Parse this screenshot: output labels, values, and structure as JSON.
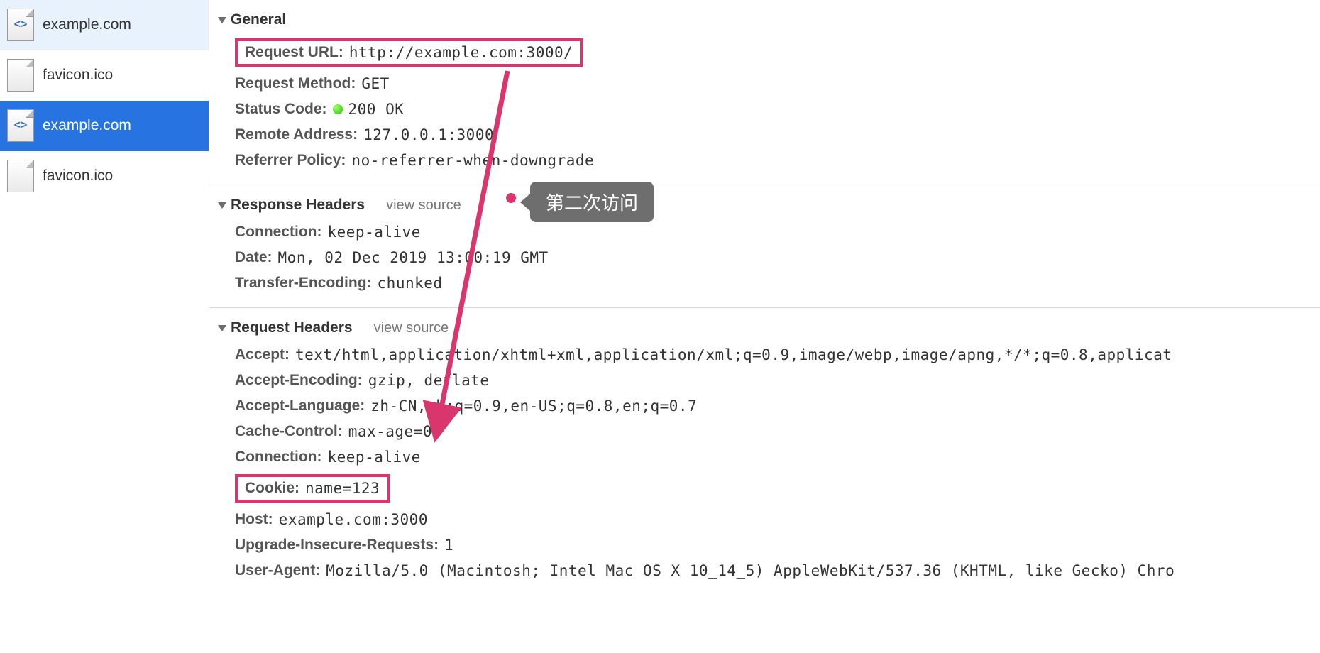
{
  "sidebar": {
    "items": [
      {
        "label": "example.com",
        "icon": "html",
        "state": "light"
      },
      {
        "label": "favicon.ico",
        "icon": "blank",
        "state": ""
      },
      {
        "label": "example.com",
        "icon": "html",
        "state": "sel"
      },
      {
        "label": "favicon.ico",
        "icon": "blank",
        "state": ""
      }
    ]
  },
  "sections": {
    "general": {
      "title": "General",
      "request_url_k": "Request URL",
      "request_url_v": "http://example.com:3000/",
      "request_method_k": "Request Method",
      "request_method_v": "GET",
      "status_code_k": "Status Code",
      "status_code_v": "200 OK",
      "remote_addr_k": "Remote Address",
      "remote_addr_v": "127.0.0.1:3000",
      "referrer_k": "Referrer Policy",
      "referrer_v": "no-referrer-when-downgrade"
    },
    "response": {
      "title": "Response Headers",
      "view_source": "view source",
      "rows": [
        {
          "k": "Connection",
          "v": "keep-alive"
        },
        {
          "k": "Date",
          "v": "Mon, 02 Dec 2019 13:00:19 GMT"
        },
        {
          "k": "Transfer-Encoding",
          "v": "chunked"
        }
      ]
    },
    "request": {
      "title": "Request Headers",
      "view_source": "view source",
      "accept_k": "Accept",
      "accept_v": "text/html,application/xhtml+xml,application/xml;q=0.9,image/webp,image/apng,*/*;q=0.8,applicat",
      "accept_enc_k": "Accept-Encoding",
      "accept_enc_v": "gzip, deflate",
      "accept_lang_k": "Accept-Language",
      "accept_lang_v": "zh-CN,zh;q=0.9,en-US;q=0.8,en;q=0.7",
      "cache_k": "Cache-Control",
      "cache_v": "max-age=0",
      "conn_k": "Connection",
      "conn_v": "keep-alive",
      "cookie_k": "Cookie",
      "cookie_v": "name=123",
      "host_k": "Host",
      "host_v": "example.com:3000",
      "upgrade_k": "Upgrade-Insecure-Requests",
      "upgrade_v": "1",
      "ua_k": "User-Agent",
      "ua_v": "Mozilla/5.0 (Macintosh; Intel Mac OS X 10_14_5) AppleWebKit/537.36 (KHTML, like Gecko) Chro"
    }
  },
  "annotation": {
    "label": "第二次访问"
  },
  "colors": {
    "highlight": "#d9366e",
    "selection": "#2773e1"
  }
}
